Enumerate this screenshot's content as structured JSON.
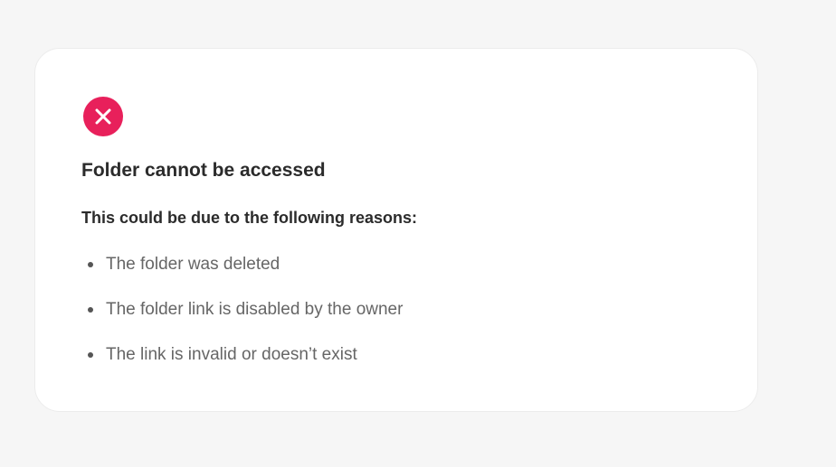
{
  "error": {
    "icon": "close-circle-icon",
    "icon_color": "#e8205b",
    "title": "Folder cannot be accessed",
    "subtitle": "This could be due to the following reasons:",
    "reasons": [
      "The folder was deleted",
      "The folder link is disabled by the owner",
      "The link is invalid or doesn’t exist"
    ]
  }
}
